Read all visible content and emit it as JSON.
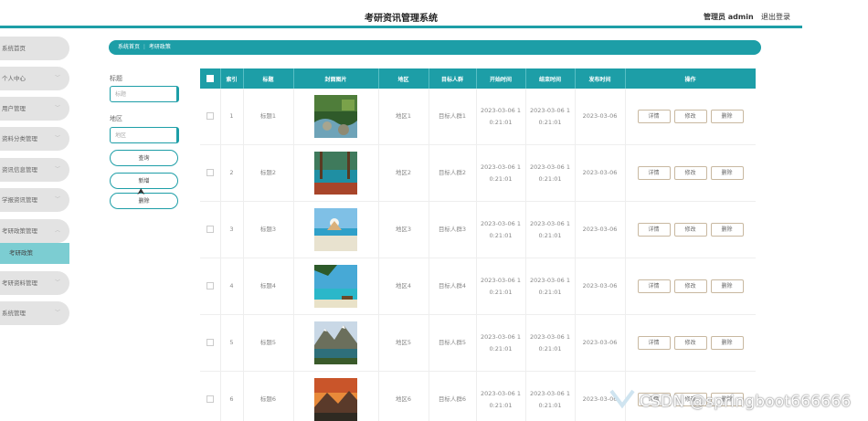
{
  "header": {
    "title": "考研资讯管理系统",
    "user": "管理员 admin",
    "logout": "退出登录"
  },
  "sidebar": {
    "items": [
      {
        "label": "系统首页",
        "chevron": false
      },
      {
        "label": "个人中心",
        "chevron": true
      },
      {
        "label": "用户管理",
        "chevron": true
      },
      {
        "label": "资料分类管理",
        "chevron": true
      },
      {
        "label": "资讯信息管理",
        "chevron": true
      },
      {
        "label": "学报资讯管理",
        "chevron": true
      },
      {
        "label": "考研政策管理",
        "chevron": true
      },
      {
        "label": "考研资料管理",
        "chevron": true
      },
      {
        "label": "系统管理",
        "chevron": true
      }
    ],
    "active_sub": "考研政策"
  },
  "breadcrumb": {
    "home": "系统首页",
    "sep": "⋮",
    "current": "考研政策"
  },
  "search": {
    "title_label": "标题",
    "title_placeholder": "标题",
    "region_label": "地区",
    "region_placeholder": "地区",
    "query_button": "查询",
    "add_button": "新增",
    "delete_button": "删除"
  },
  "table": {
    "headers": [
      "索引",
      "标题",
      "封面图片",
      "地区",
      "目标人群",
      "开始时间",
      "结束时间",
      "发布时间",
      "操作"
    ],
    "rows": [
      {
        "index": "1",
        "title": "标题1",
        "image": "stream",
        "region": "地区1",
        "target": "目标人群1",
        "start_a": "2023-03-06 1",
        "start_b": "0:21:01",
        "end_a": "2023-03-06 1",
        "end_b": "0:21:01",
        "publish": "2023-03-06"
      },
      {
        "index": "2",
        "title": "标题2",
        "image": "lake",
        "region": "地区2",
        "target": "目标人群2",
        "start_a": "2023-03-06 1",
        "start_b": "0:21:01",
        "end_a": "2023-03-06 1",
        "end_b": "0:21:01",
        "publish": "2023-03-06"
      },
      {
        "index": "3",
        "title": "标题3",
        "image": "beach",
        "region": "地区3",
        "target": "目标人群3",
        "start_a": "2023-03-06 1",
        "start_b": "0:21:01",
        "end_a": "2023-03-06 1",
        "end_b": "0:21:01",
        "publish": "2023-03-06"
      },
      {
        "index": "4",
        "title": "标题4",
        "image": "palm-beach",
        "region": "地区4",
        "target": "目标人群4",
        "start_a": "2023-03-06 1",
        "start_b": "0:21:01",
        "end_a": "2023-03-06 1",
        "end_b": "0:21:01",
        "publish": "2023-03-06"
      },
      {
        "index": "5",
        "title": "标题5",
        "image": "mountain-lake",
        "region": "地区5",
        "target": "目标人群5",
        "start_a": "2023-03-06 1",
        "start_b": "0:21:01",
        "end_a": "2023-03-06 1",
        "end_b": "0:21:01",
        "publish": "2023-03-06"
      },
      {
        "index": "6",
        "title": "标题6",
        "image": "sunset-mountain",
        "region": "地区6",
        "target": "目标人群6",
        "start_a": "2023-03-06 1",
        "start_b": "0:21:01",
        "end_a": "2023-03-06 1",
        "end_b": "0:21:01",
        "publish": "2023-03-06"
      }
    ],
    "actions": {
      "detail": "详情",
      "edit": "修改",
      "delete": "删除"
    }
  },
  "watermark": "CSDN @springboot666666",
  "colors": {
    "accent": "#1d9ea7",
    "active_sub": "#7ccdd2"
  }
}
